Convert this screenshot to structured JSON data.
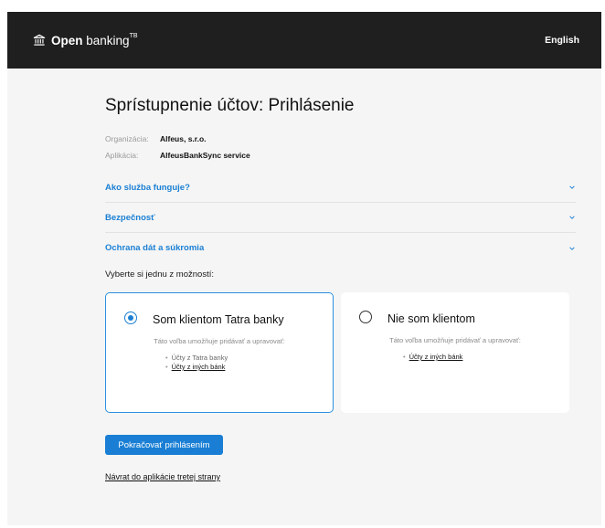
{
  "header": {
    "brand_bold": "Open",
    "brand_rest": " banking",
    "brand_sup": "TB",
    "brand_icon": "bank-icon",
    "language": "English"
  },
  "page": {
    "title": "Sprístupnenie účtov: Prihlásenie"
  },
  "meta": {
    "org_label": "Organizácia:",
    "org_value": "Alfeus, s.r.o.",
    "app_label": "Aplikácia:",
    "app_value": "AlfeusBankSync service"
  },
  "accordion": [
    {
      "label": "Ako služba funguje?",
      "icon": "chevron-down-icon"
    },
    {
      "label": "Bezpečnosť",
      "icon": "chevron-down-icon"
    },
    {
      "label": "Ochrana dát a súkromia",
      "icon": "chevron-down-icon"
    }
  ],
  "choose_label": "Vyberte si jednu z možností:",
  "options": [
    {
      "title": "Som klientom Tatra banky",
      "desc": "Táto voľba umožňuje pridávať a upravovať:",
      "selected": true,
      "items": [
        {
          "text": "Účty z Tatra banky",
          "link": false
        },
        {
          "text": "Účty z iných bánk",
          "link": true
        }
      ]
    },
    {
      "title": "Nie som klientom",
      "desc": "Táto voľba umožňuje pridávať a upravovať:",
      "selected": false,
      "items": [
        {
          "text": "Účty z iných bánk",
          "link": true
        }
      ]
    }
  ],
  "actions": {
    "continue_label": "Pokračovať prihlásením",
    "back_label": "Návrat do aplikácie tretej strany"
  },
  "colors": {
    "accent": "#1a7fd4",
    "header_bg": "#1f1f1f",
    "content_bg": "#f5f5f5"
  }
}
